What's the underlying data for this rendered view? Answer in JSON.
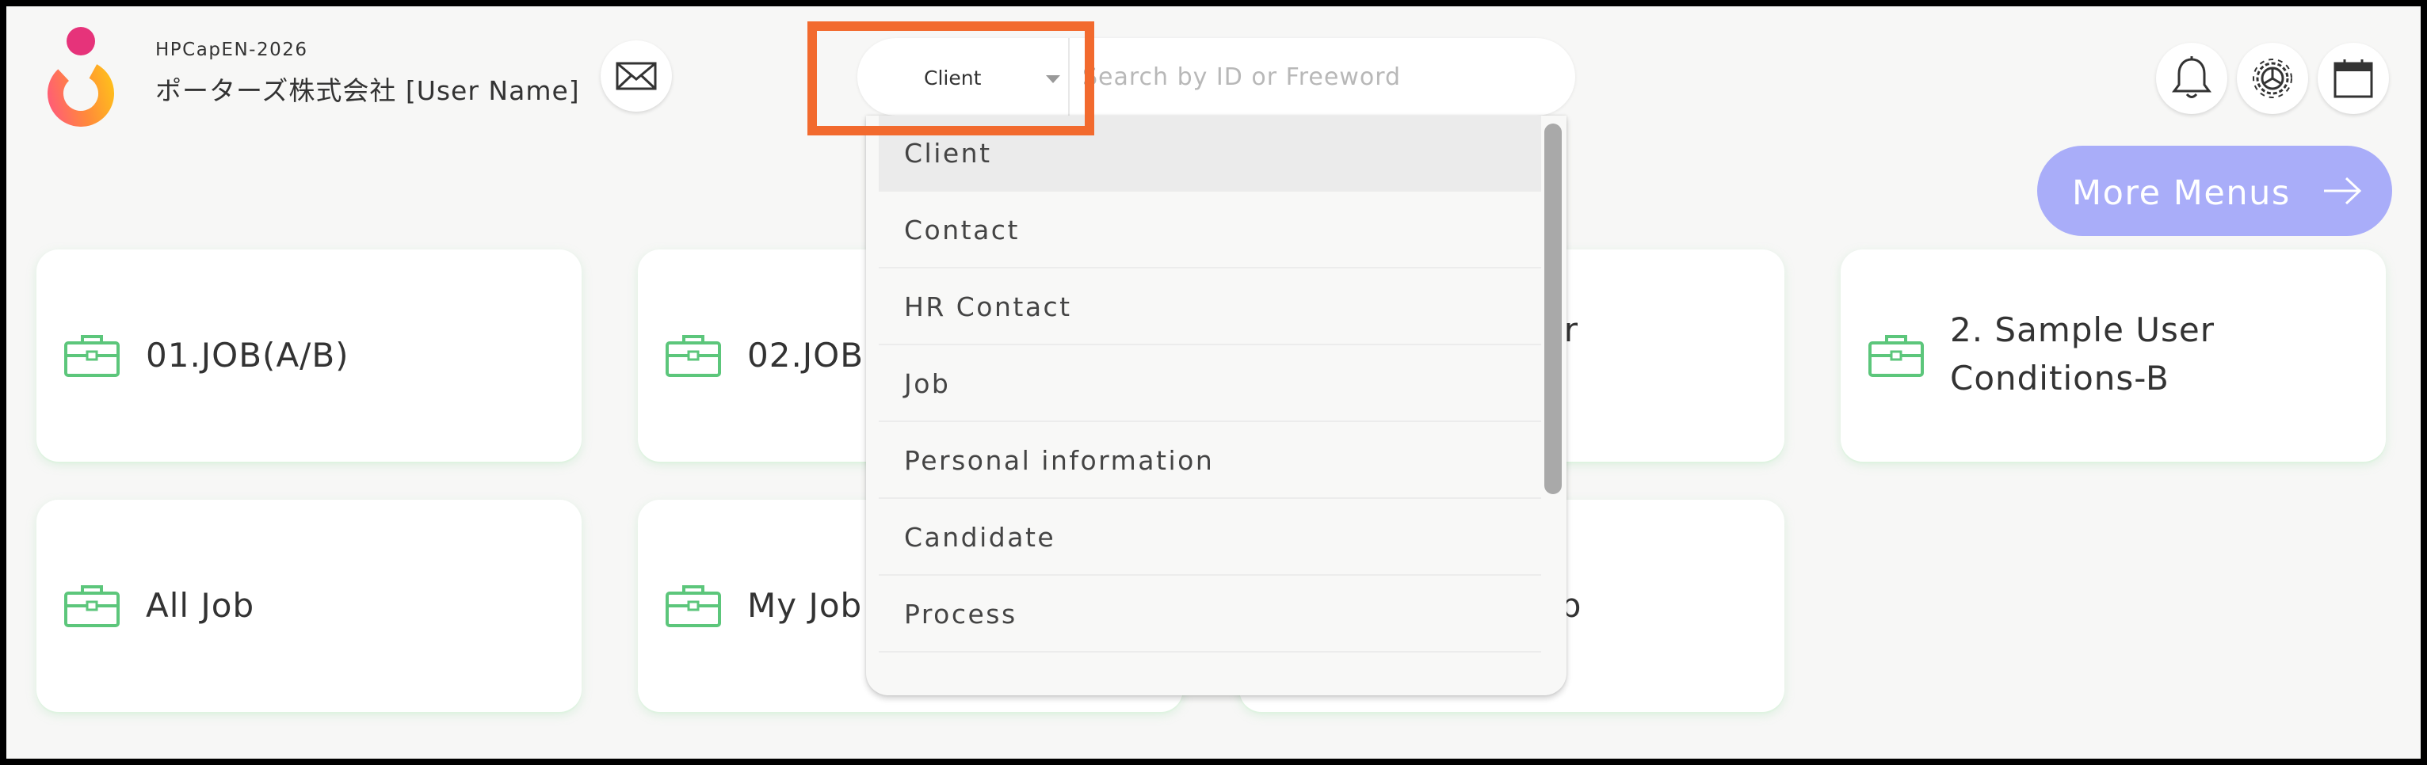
{
  "header": {
    "company_code": "HPCapEN-2026",
    "company_name": "ポーターズ株式会社 [User Name]",
    "icons": [
      "logo",
      "mail-icon",
      "bell-icon",
      "gear-icon",
      "calendar-icon"
    ]
  },
  "search": {
    "selected_type": "Client",
    "placeholder": "Search by ID or Freeword"
  },
  "more_menus": {
    "label": "More Menus",
    "color": "#a9adf9"
  },
  "cards": [
    {
      "label": "01.JOB(A/B)"
    },
    {
      "label": "02.JOB"
    },
    {
      "label": "ser\nA"
    },
    {
      "label": "2. Sample User Conditions-B"
    },
    {
      "label": "All Job"
    },
    {
      "label": "My Job"
    },
    {
      "label": "ob"
    }
  ],
  "dropdown": {
    "items": [
      {
        "label": "Client",
        "active": true
      },
      {
        "label": "Contact"
      },
      {
        "label": "HR Contact"
      },
      {
        "label": "Job"
      },
      {
        "label": "Personal information"
      },
      {
        "label": "Candidate"
      },
      {
        "label": "Process"
      }
    ]
  },
  "colors": {
    "highlight": "#f26a2e",
    "card_icon": "#5cc67b",
    "background": "#f7f7f6"
  }
}
